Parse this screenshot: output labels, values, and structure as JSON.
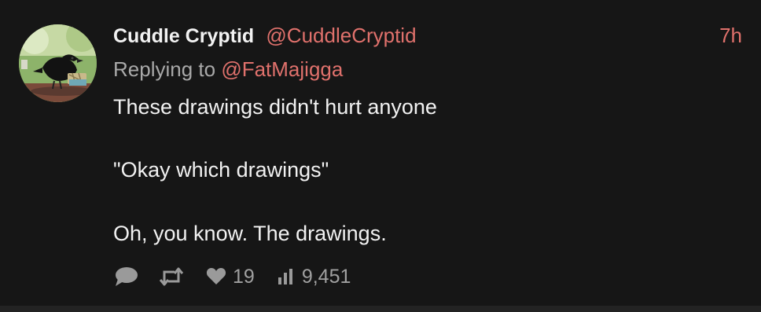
{
  "tweet": {
    "display_name": "Cuddle Cryptid",
    "handle": "@CuddleCryptid",
    "timestamp": "7h",
    "replying_prefix": "Replying to",
    "replying_to": "@FatMajigga",
    "lines": [
      "These drawings didn't hurt anyone",
      "\"Okay which drawings\"",
      "Oh, you know. The drawings."
    ],
    "stats": {
      "likes": "19",
      "views": "9,451"
    }
  },
  "icons": {
    "reply": "speech-bubble-icon",
    "retweet": "retweet-icon",
    "like": "heart-icon",
    "views": "bar-chart-icon"
  },
  "colors": {
    "background": "#161616",
    "accent": "#e0716c",
    "text": "#f2f2f2",
    "muted": "#a9a9a9"
  }
}
